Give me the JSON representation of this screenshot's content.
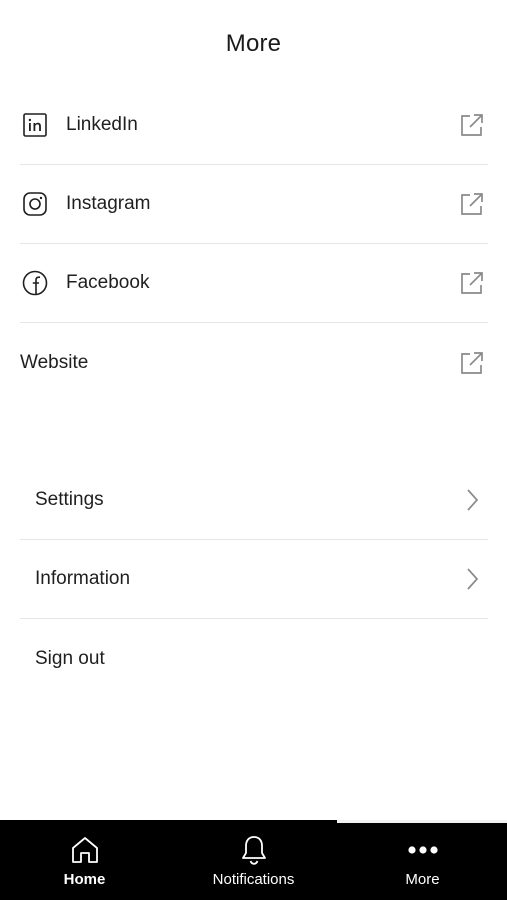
{
  "header": {
    "title": "More"
  },
  "links": [
    {
      "label": "LinkedIn",
      "icon": "linkedin-icon",
      "trailing_icon": "external-link-icon"
    },
    {
      "label": "Instagram",
      "icon": "instagram-icon",
      "trailing_icon": "external-link-icon"
    },
    {
      "label": "Facebook",
      "icon": "facebook-icon",
      "trailing_icon": "external-link-icon"
    },
    {
      "label": "Website",
      "icon": null,
      "trailing_icon": "external-link-icon"
    }
  ],
  "actions": [
    {
      "label": "Settings",
      "trailing_icon": "chevron-right-icon"
    },
    {
      "label": "Information",
      "trailing_icon": "chevron-right-icon"
    },
    {
      "label": "Sign out",
      "trailing_icon": null
    }
  ],
  "tabbar": {
    "tabs": [
      {
        "label": "Home",
        "icon": "home-icon",
        "active": true
      },
      {
        "label": "Notifications",
        "icon": "bell-icon",
        "active": false
      },
      {
        "label": "More",
        "icon": "more-dots-icon",
        "active": false
      }
    ]
  },
  "colors": {
    "background": "#ffffff",
    "text": "#1f1f1f",
    "divider": "#e6e6e6",
    "icon_gray": "#8a8a8a",
    "tabbar_bg": "#000000",
    "tabbar_text": "#ffffff"
  }
}
